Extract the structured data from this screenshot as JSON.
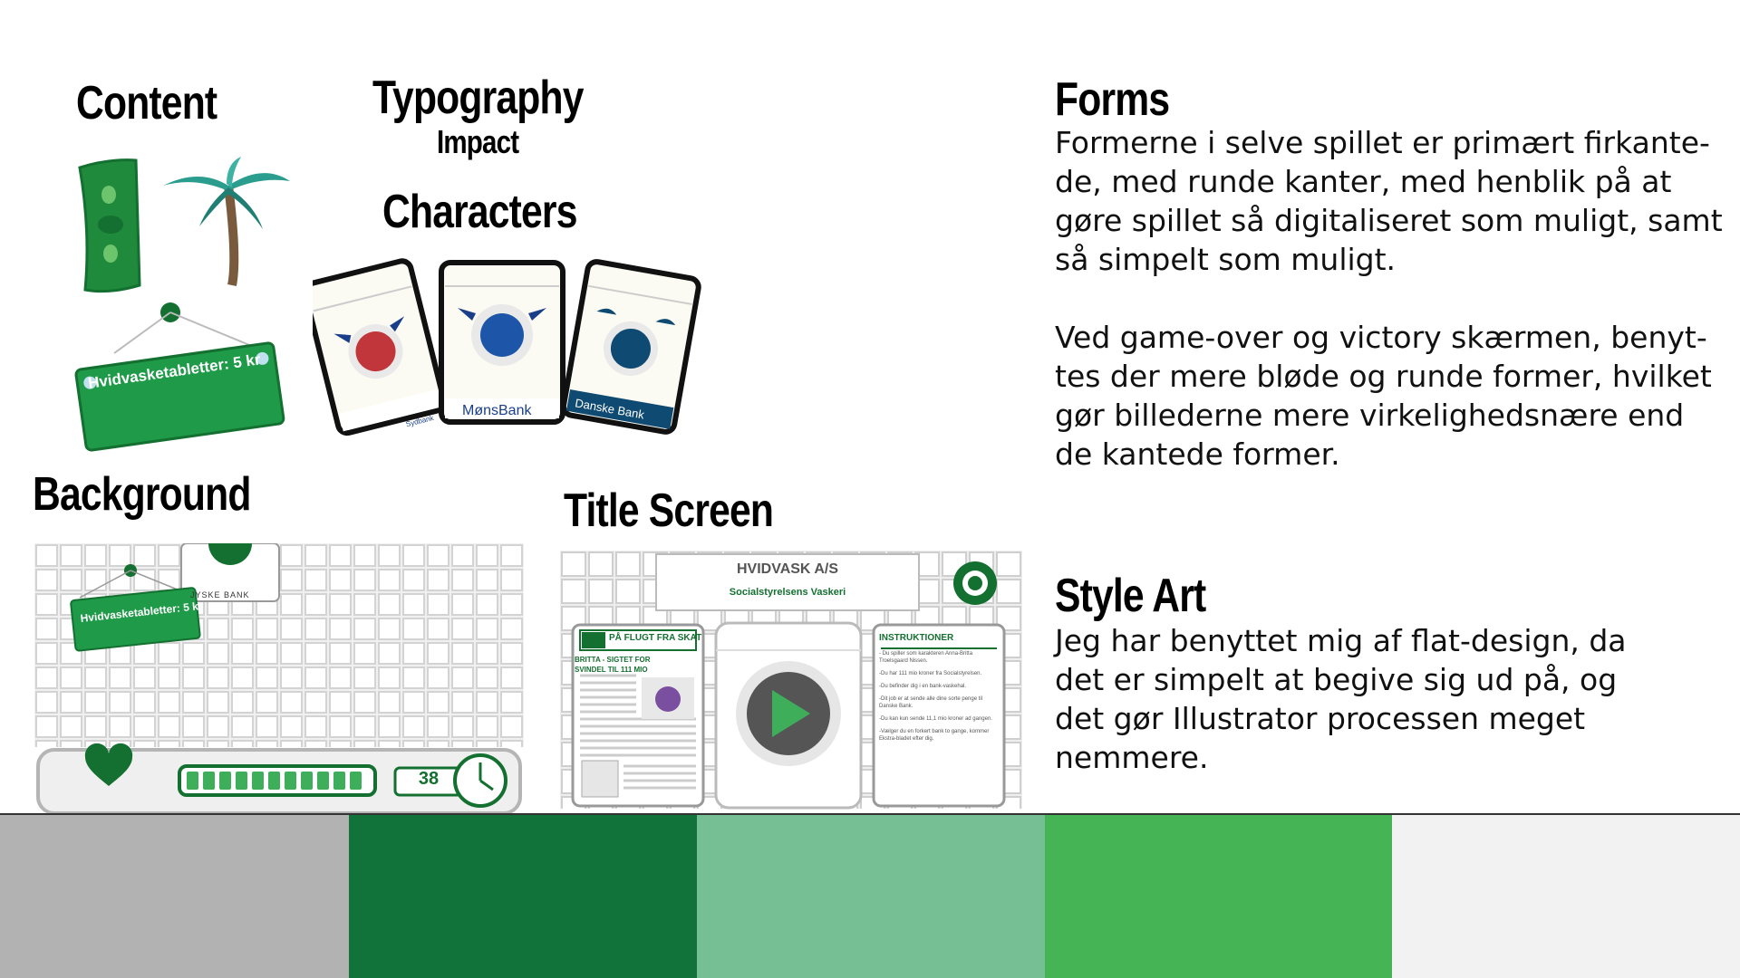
{
  "headings": {
    "content": "Content",
    "typography": "Typography",
    "typography_font": "Impact",
    "characters": "Characters",
    "background": "Background",
    "title_screen": "Title Screen",
    "forms": "Forms",
    "style_art": "Style Art"
  },
  "forms_text": [
    "Formerne i selve spillet er primært firkante-",
    "de, med runde kanter, med henblik på at",
    "gøre spillet så digitaliseret som muligt, samt",
    "så simpelt som muligt.",
    "",
    "Ved game-over og victory skærmen, benyt-",
    "tes der mere bløde og runde former, hvilket",
    "gør billederne mere virkelighedsnære end",
    "de kantede former."
  ],
  "style_text": [
    "Jeg har benyttet mig af flat-design, da",
    "det er simpelt at begive sig ud på, og",
    "det gør Illustrator processen meget",
    "nemmere."
  ],
  "content_sign": "Hvidvasketabletter: 5 kr",
  "characters": {
    "card1_bank": "Sydbank",
    "card2_bank": "MønsBank",
    "card3_bank": "Danske Bank"
  },
  "background": {
    "sign": "Hvidvasketabletter: 5 kr",
    "bank_label": "JYSKE BANK",
    "counter": "38"
  },
  "title_screen": {
    "title": "HVIDVASK A/S",
    "subtitle": "Socialstyrelsens Vaskeri",
    "news_header": "PÅ FLUGT FRA SKAT",
    "news_headline_1": "BRITTA - SIGTET FOR",
    "news_headline_2": "SVINDEL TIL 111 MIO",
    "instructions_header": "INSTRUKTIONER",
    "instructions": [
      "- Du spiller som karakteren Anna-Britta Troelsgaard Nissen.",
      "-Du har 111 mio kroner fra Socialstyrelsen.",
      "-Du befinder dig i en bank-vaskehal.",
      "-Dit job er at sende alle dine sorte penge til Danske Bank.",
      "-Du kan kun sende 11,1 mio kroner ad gangen.",
      "-Vælger du en forkert bank to gange, kommer Ekstra-bladet efter dig."
    ]
  },
  "palette": [
    "#b2b2b2",
    "#12733a",
    "#76bf94",
    "#45b454",
    "#f2f2f2"
  ]
}
